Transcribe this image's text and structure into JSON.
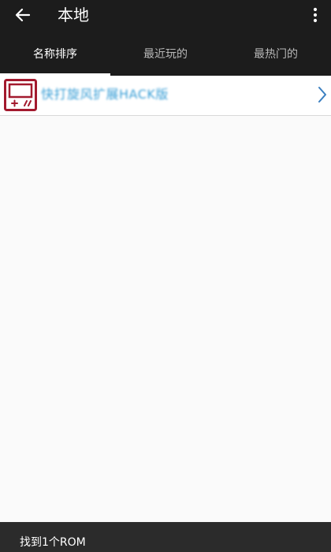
{
  "header": {
    "title": "本地",
    "back_icon": "arrow-left-icon",
    "more_icon": "more-vertical-icon"
  },
  "tabs": [
    {
      "label": "名称排序",
      "active": true
    },
    {
      "label": "最近玩的",
      "active": false
    },
    {
      "label": "最热门的",
      "active": false
    }
  ],
  "roms": [
    {
      "name": "快打旋风扩展HACK版",
      "icon": "game-console-icon",
      "chevron_icon": "chevron-right-icon"
    }
  ],
  "footer": {
    "status": "找到1个ROM"
  },
  "colors": {
    "toolbar_bg": "#1c1c1c",
    "rom_name": "#3a9fd6",
    "icon_accent": "#a31a2e",
    "chevron": "#3a7fc0",
    "footer_bg": "#2b2b2b"
  }
}
